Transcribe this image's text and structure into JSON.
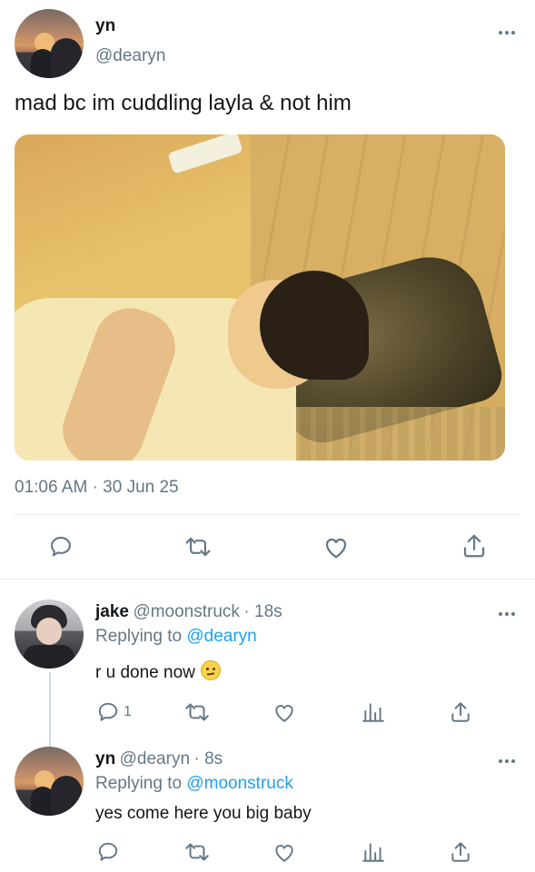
{
  "main_tweet": {
    "name": "yn",
    "handle": "@dearyn",
    "text": "mad bc im cuddling layla & not him",
    "timestamp": "01:06 AM · 30 Jun 25"
  },
  "replies": [
    {
      "name": "jake",
      "handle": "@moonstruck",
      "time": "· 18s",
      "replying_to_prefix": "Replying to",
      "replying_to": "@dearyn",
      "text": "r u done now",
      "reply_count": "1"
    },
    {
      "name": "yn",
      "handle": "@dearyn",
      "time": "· 8s",
      "replying_to_prefix": "Replying to",
      "replying_to": "@moonstruck",
      "text": "yes come here you big baby"
    }
  ],
  "icons": [
    "more-icon",
    "reply-icon",
    "retweet-icon",
    "like-icon",
    "share-icon",
    "analytics-icon"
  ],
  "colors": {
    "link": "#1da1f2",
    "muted": "#657786",
    "text": "#14171a",
    "divider": "#e6ecf0"
  }
}
